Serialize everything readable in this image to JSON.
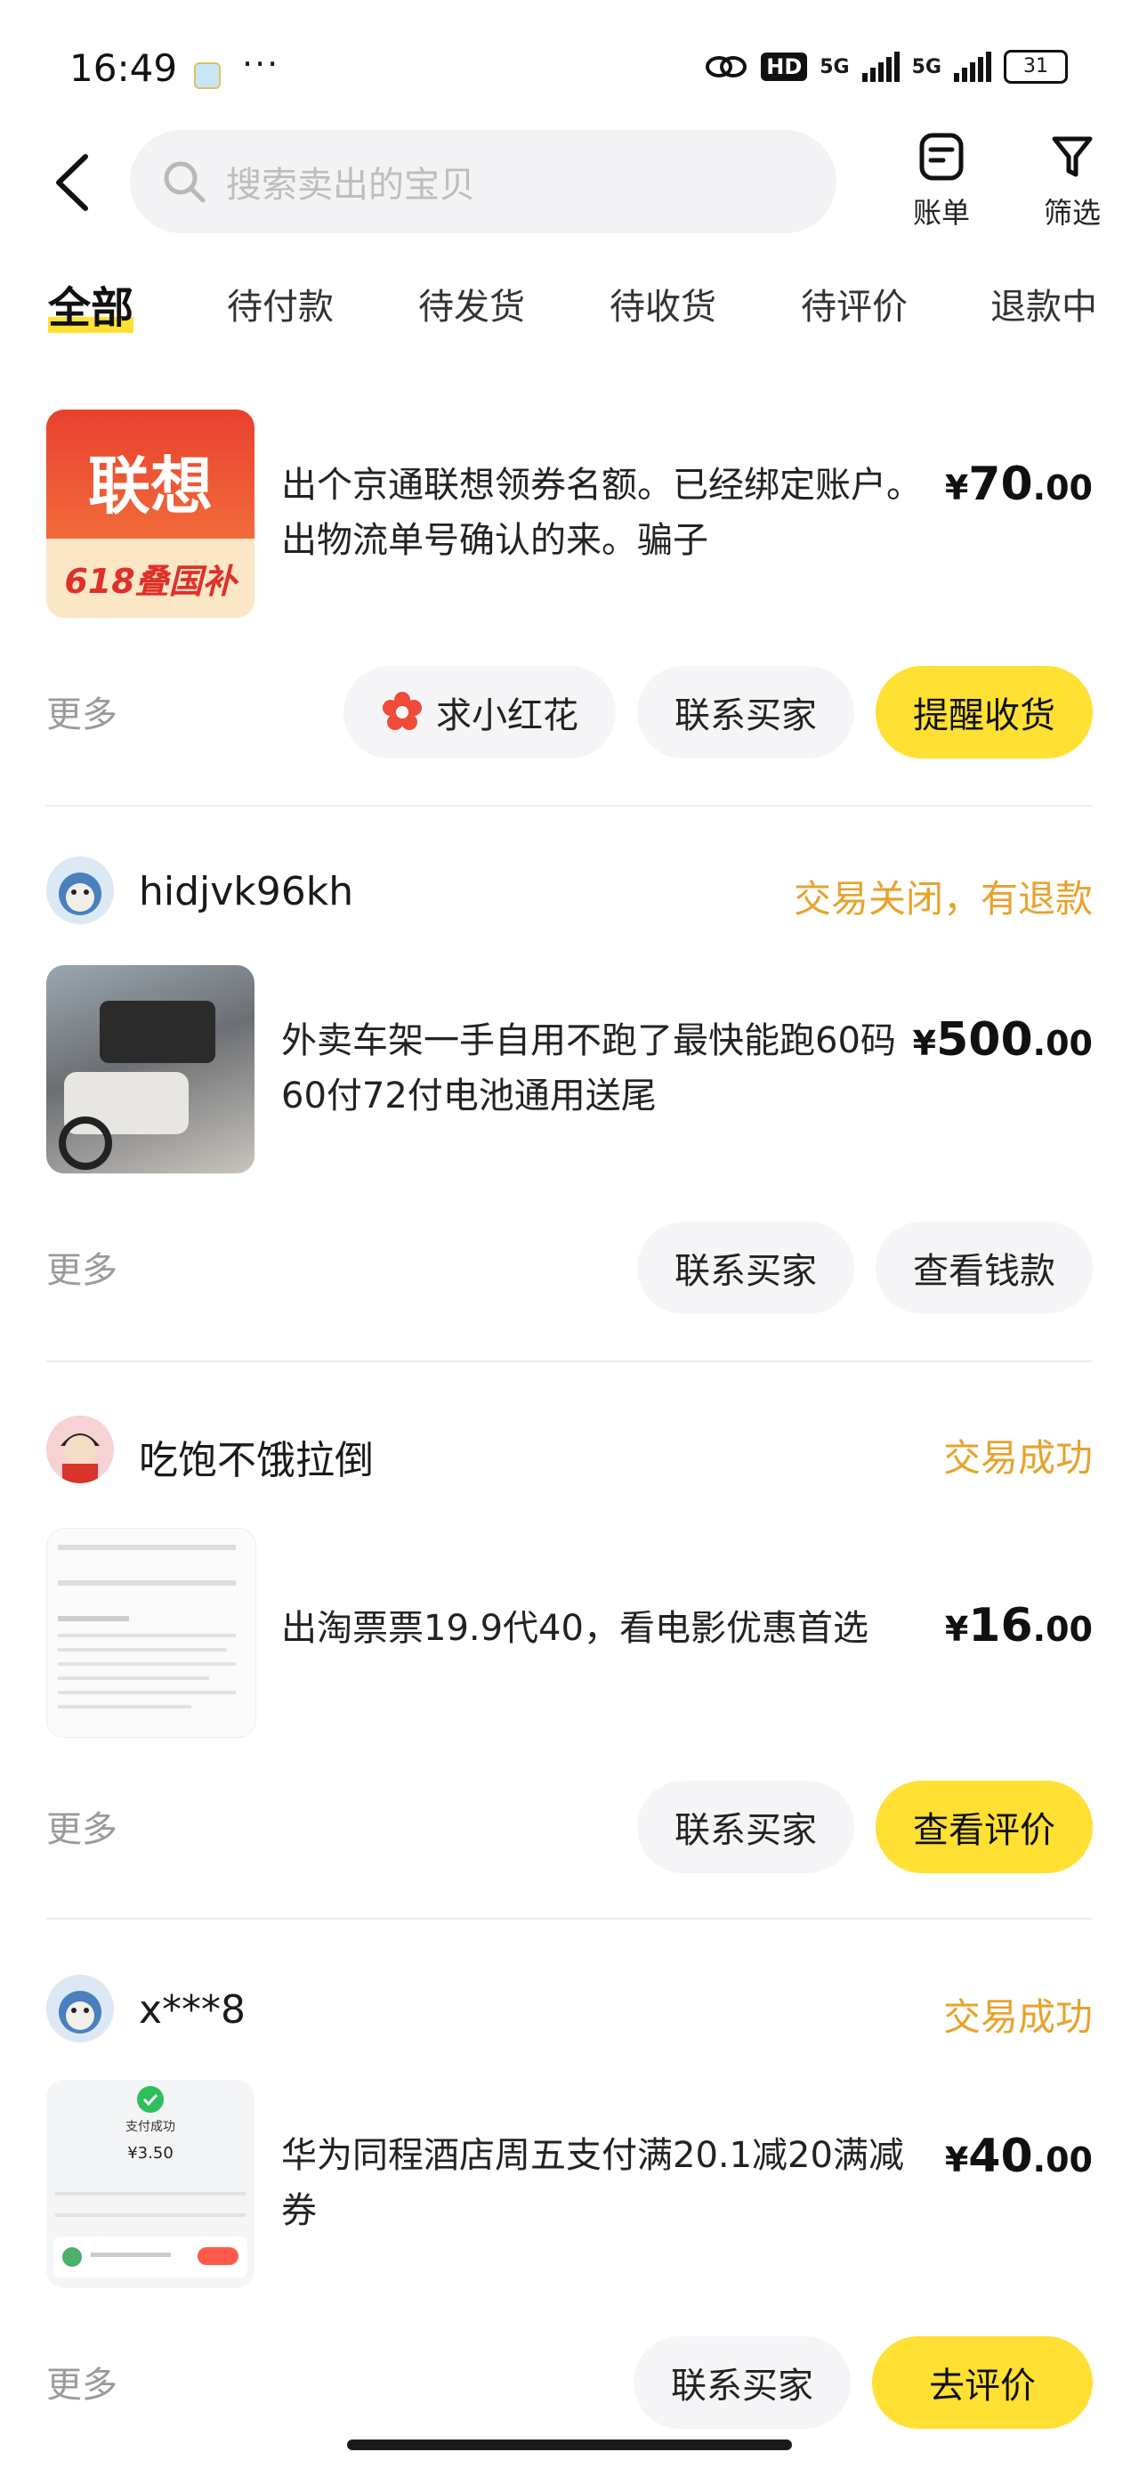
{
  "status_bar": {
    "time": "16:49",
    "dots": "···",
    "hd": "HD",
    "net1": "5G",
    "net2": "5G",
    "battery": "31"
  },
  "header": {
    "search_placeholder": "搜索卖出的宝贝",
    "bill_label": "账单",
    "filter_label": "筛选"
  },
  "tabs": [
    {
      "label": "全部",
      "active": true
    },
    {
      "label": "待付款"
    },
    {
      "label": "待发货"
    },
    {
      "label": "待收货"
    },
    {
      "label": "待评价"
    },
    {
      "label": "退款中"
    }
  ],
  "orders": [
    {
      "thumb_text_top": "联想",
      "thumb_text_bottom": "618叠国补",
      "title": "出个京通联想领券名额。已经绑定账户。出物流单号确认的来。骗子",
      "price_currency": "¥",
      "price_int": "70",
      "price_dec": ".00",
      "more": "更多",
      "buttons": [
        "求小红花",
        "联系买家",
        "提醒收货"
      ]
    },
    {
      "buyer": "hidjvk96kh",
      "status": "交易关闭，有退款",
      "title": "外卖车架一手自用不跑了最快能跑60码60付72付电池通用送尾",
      "price_currency": "¥",
      "price_int": "500",
      "price_dec": ".00",
      "more": "更多",
      "buttons": [
        "联系买家",
        "查看钱款"
      ]
    },
    {
      "buyer": "吃饱不饿拉倒",
      "status": "交易成功",
      "title": "出淘票票19.9代40，看电影优惠首选",
      "price_currency": "¥",
      "price_int": "16",
      "price_dec": ".00",
      "more": "更多",
      "buttons": [
        "联系买家",
        "查看评价"
      ]
    },
    {
      "buyer": "x***8",
      "status": "交易成功",
      "thumb_label": "支付成功",
      "thumb_amount": "¥3.50",
      "title": "华为同程酒店周五支付满20.1减20满减券",
      "price_currency": "¥",
      "price_int": "40",
      "price_dec": ".00",
      "more": "更多",
      "buttons": [
        "联系买家",
        "去评价"
      ]
    }
  ],
  "colors": {
    "accent_yellow": "#ffe033",
    "status_orange": "#e8a22c",
    "muted_gray": "#9a9a9a"
  }
}
